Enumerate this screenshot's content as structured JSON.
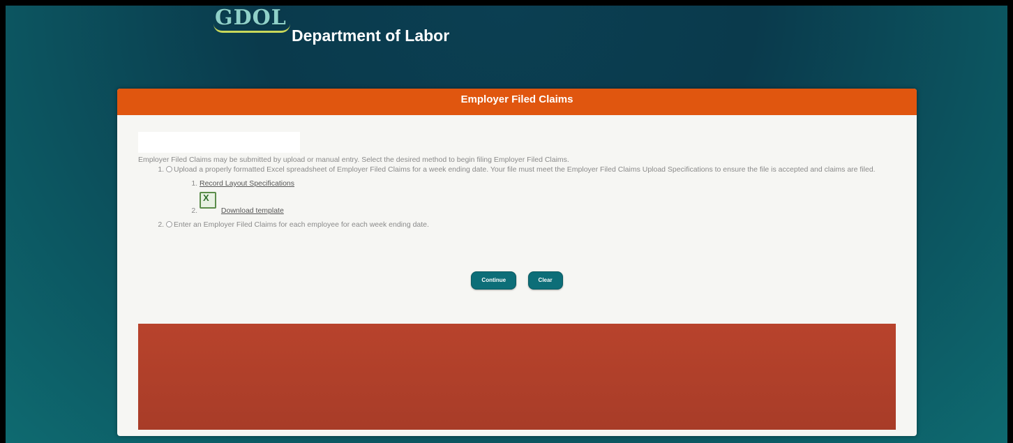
{
  "header": {
    "logo_text": "GDOL",
    "department_title": "Department of Labor"
  },
  "panel": {
    "title": "Employer Filed Claims",
    "intro": "Employer Filed Claims may be submitted by upload or manual entry. Select the desired method to begin filing Employer Filed Claims.",
    "options": [
      {
        "text": "Upload a properly formatted Excel spreadsheet of Employer Filed Claims for a week ending date. Your file must meet the Employer Filed Claims Upload Specifications to ensure the file is accepted and claims are filed."
      },
      {
        "text": "Enter an Employer Filed Claims for each employee for each week ending date."
      }
    ],
    "links": {
      "record_layout": "Record Layout Specifications",
      "download_template": "Download template"
    },
    "buttons": {
      "continue": "Continue",
      "clear": "Clear"
    }
  },
  "colors": {
    "header_bar": "#e0560f",
    "button": "#0d6e78",
    "footer_block": "#b0402a",
    "background": "#0a3a4c"
  },
  "icons": {
    "excel": "excel-file-icon"
  }
}
